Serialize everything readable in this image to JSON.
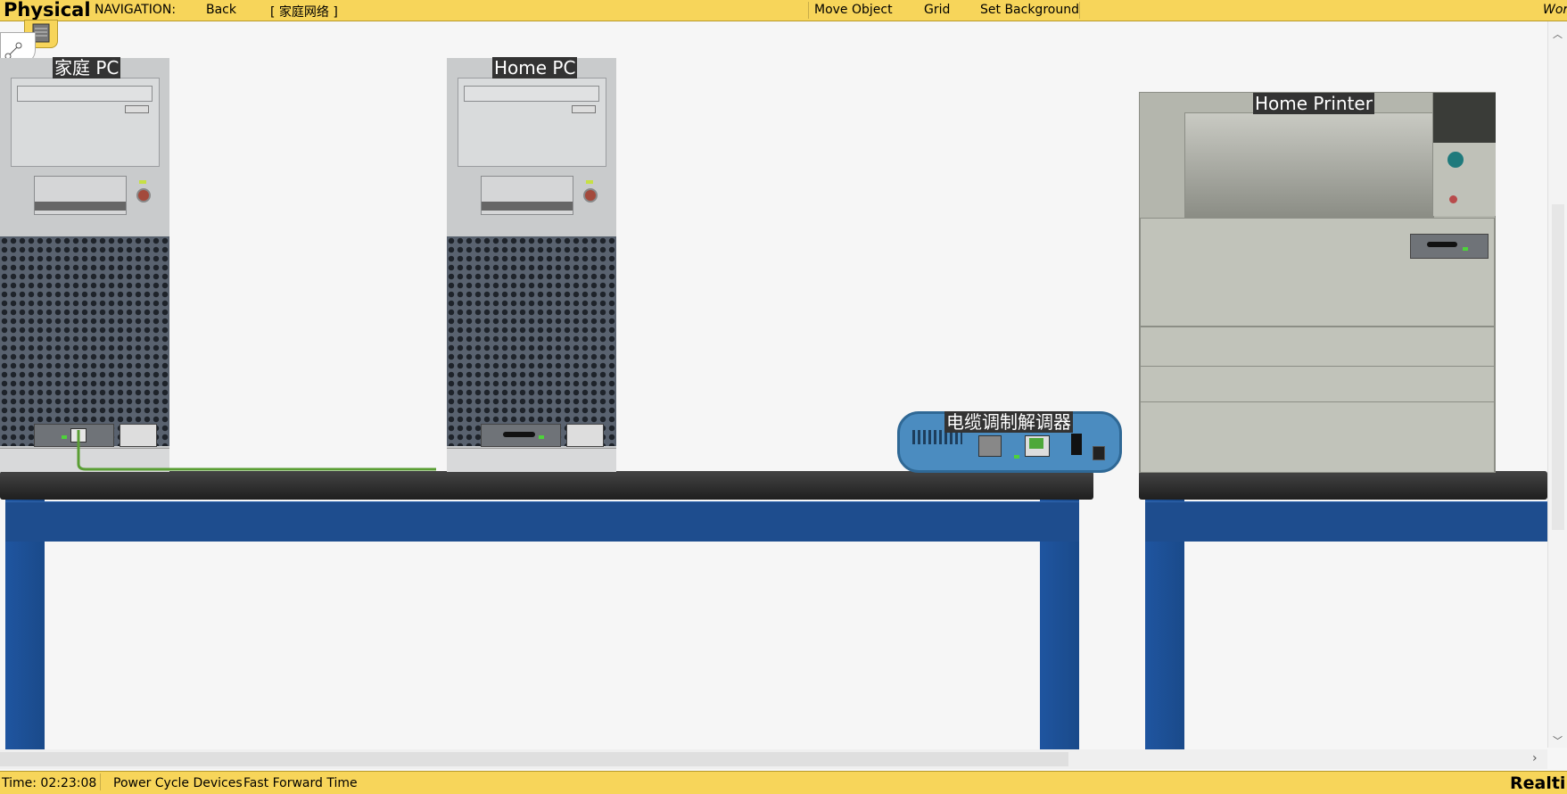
{
  "topbar": {
    "mode": "Physical",
    "nav_label": "NAVIGATION:",
    "back": "Back",
    "location": "[ 家庭网络 ]",
    "move_object": "Move Object",
    "grid": "Grid",
    "set_background": "Set Background",
    "workspace_partial": "Work"
  },
  "devices": {
    "pc1_label": "家庭 PC",
    "pc2_label": "Home PC",
    "printer_label": "Home Printer",
    "modem_label": "电缆调制解调器"
  },
  "bottombar": {
    "time": "Time: 02:23:08",
    "power_cycle": "Power Cycle Devices",
    "fast_forward": "Fast Forward Time",
    "realtime_partial": "Realti"
  },
  "colors": {
    "bar": "#f7d55a",
    "desk_leg": "#1e4d8e",
    "cable": "#5a9e34"
  }
}
